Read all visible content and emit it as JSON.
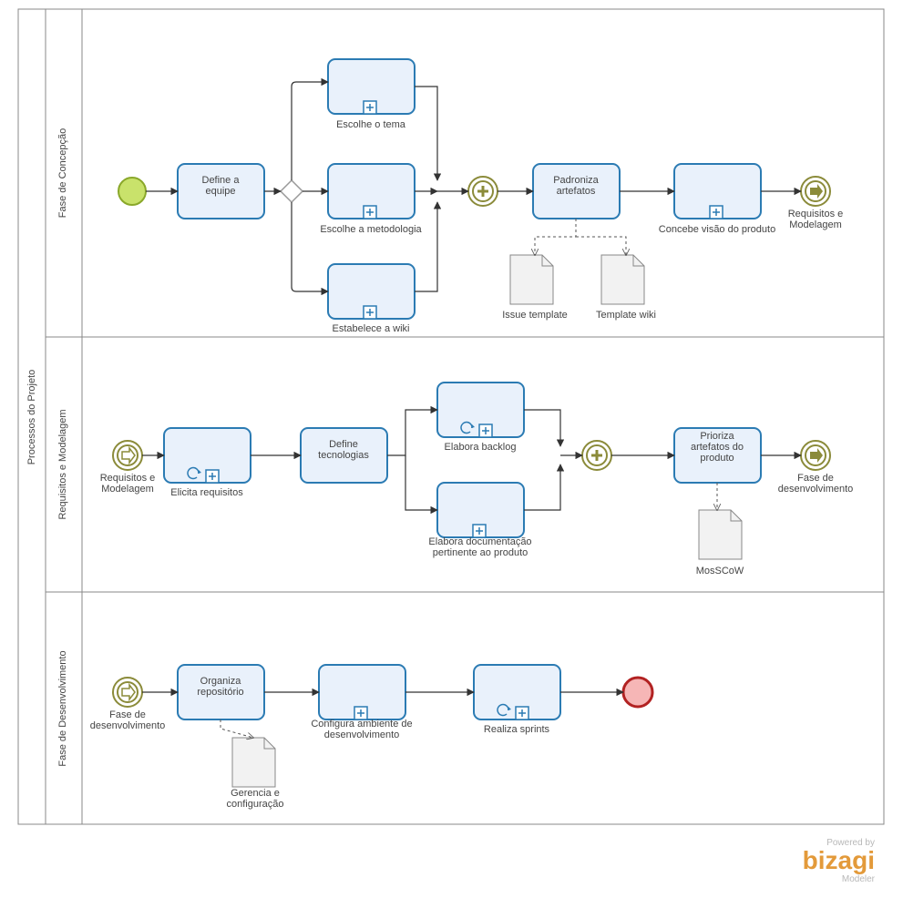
{
  "pool": {
    "title": "Processos do Projeto"
  },
  "lanes": {
    "l1": "Fase de Concepção",
    "l2": "Requisitos e Modelagem",
    "l3": "Fase de Desenvolvimento"
  },
  "tasks": {
    "defineEquipe": "Define a\nequipe",
    "escolheTema": "Escolhe o tema",
    "escolheMetodologia": "Escolhe a metodologia",
    "estabeleceWiki": "Estabelece a wiki",
    "padronizaArtefatos": "Padroniza\nartefatos",
    "concebeVisao": "Concebe visão do produto",
    "elicitaRequisitos": "Elicita requisitos",
    "defineTecnologias": "Define\ntecnologias",
    "elaboraBacklog": "Elabora backlog",
    "elaboraDocumentacao": "Elabora documentação\npertinente ao produto",
    "priorizaArtefatos": "Prioriza\nartefatos do\nproduto",
    "organizaRepositorio": "Organiza\nrepositório",
    "configuraAmbiente": "Configura ambiente de\ndesenvolvimento",
    "realizaSprints": "Realiza sprints"
  },
  "docs": {
    "issueTemplate": "Issue template",
    "templateWiki": "Template wiki",
    "moscow": "MosSCoW",
    "gerenciaConfig": "Gerencia e\nconfiguração"
  },
  "links": {
    "reqModOut": "Requisitos e\nModelagem",
    "reqModIn": "Requisitos e\nModelagem",
    "faseDevOut": "Fase de\ndesenvolvimento",
    "faseDevIn": "Fase de\ndesenvolvimento"
  },
  "branding": {
    "poweredBy": "Powered by",
    "logo": "bizagi",
    "tagline": "Modeler"
  }
}
